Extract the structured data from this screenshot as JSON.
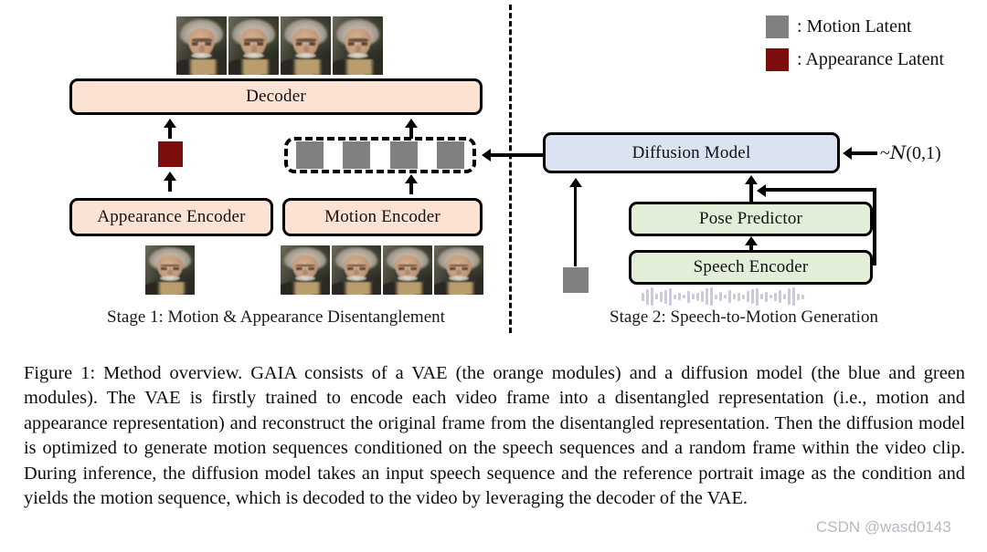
{
  "figure": {
    "caption": "Figure 1: Method overview. GAIA consists of a VAE (the orange modules) and a diffusion model (the blue and green modules). The VAE is firstly trained to encode each video frame into a disentangled representation (i.e., motion and appearance representation) and reconstruct the original frame from the disentangled representation. Then the diffusion model is optimized to generate motion sequences conditioned on the speech sequences and a random frame within the video clip. During inference, the diffusion model takes an input speech sequence and the reference portrait image as the condition and yields the motion sequence, which is decoded to the video by leveraging the decoder of the VAE."
  },
  "legend": {
    "items": [
      {
        "swatch": "motion",
        "color": "#808080",
        "label": ": Motion Latent"
      },
      {
        "swatch": "appearance",
        "color": "#7d0c0c",
        "label": ": Appearance Latent"
      }
    ]
  },
  "diagram": {
    "stage1": {
      "caption": "Stage 1: Motion & Appearance Disentanglement",
      "boxes": {
        "decoder": "Decoder",
        "appearance_encoder": "Appearance Encoder",
        "motion_encoder": "Motion Encoder"
      },
      "motion_latent_count": 4,
      "output_frame_count": 4,
      "input_frame_count": 4,
      "reference_frame_count": 1
    },
    "stage2": {
      "caption": "Stage 2: Speech-to-Motion Generation",
      "boxes": {
        "diffusion_model": "Diffusion Model",
        "pose_predictor": "Pose Predictor",
        "speech_encoder": "Speech Encoder"
      },
      "noise_input": "~N(0,1)",
      "noise_tilde": "~",
      "noise_script_n": "N",
      "noise_args": "(0,1)",
      "waveform_bar_heights": [
        9,
        17,
        20,
        6,
        11,
        15,
        19,
        5,
        8,
        4,
        13,
        6,
        9,
        12,
        18,
        20,
        5,
        10,
        4,
        14,
        6,
        9,
        5,
        12,
        16,
        19,
        6,
        11,
        4,
        9,
        14,
        6,
        18,
        20,
        7,
        5
      ]
    }
  },
  "colors": {
    "vae_module": "#fbe2d3",
    "diffusion_module": "#dbe2f2",
    "speech_module": "#e3eed9",
    "motion_latent": "#808080",
    "appearance_latent": "#7d0c0c",
    "stroke": "#000000",
    "waveform": "#c9cada"
  },
  "watermark": {
    "text": "CSDN @wasd0143"
  }
}
